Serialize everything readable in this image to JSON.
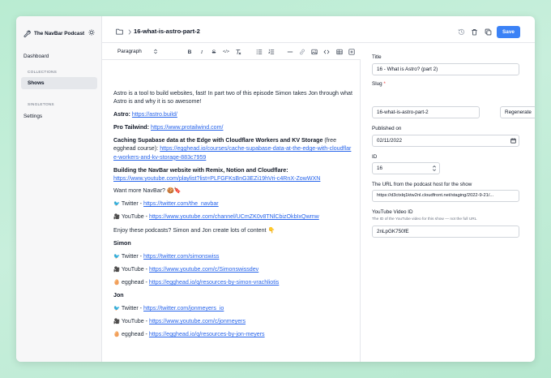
{
  "sidebar": {
    "brand": "The NavBar Podcast",
    "dashboard": "Dashboard",
    "collections_heading": "COLLECTIONS",
    "shows": "Shows",
    "singletons_heading": "SINGLETONS",
    "settings": "Settings"
  },
  "header": {
    "doc_title": "16-what-is-astro-part-2",
    "save_label": "Save"
  },
  "toolbar": {
    "paragraph_label": "Paragraph",
    "bold": "B",
    "italic": "I",
    "strike": "S",
    "code": "</>"
  },
  "content": {
    "intro": "Astro is a tool to build websites, fast! In part two of this episode Simon takes Jon through what Astro is and why it is so awesome!",
    "astro_label": "Astro:",
    "astro_url": "https://astro.build/",
    "tailwind_label": "Pro Tailwind:",
    "tailwind_url": "https://www.protailwind.com/",
    "supabase_label": "Caching Supabase data at the Edge with Cloudflare Workers and KV Storage",
    "supabase_note": " (free egghead course): ",
    "supabase_url": "https://egghead.io/courses/cache-supabase-data-at-the-edge-with-cloudflare-workers-and-kv-storage-883c7959",
    "navbar_build_label": "Building the NavBar website with Remix, Notion and Cloudflare",
    "navbar_build_url": "https://www.youtube.com/playlist?list=PLFGFKsBnG3EZi19hVri-c4RnX-ZowWXN",
    "want_more": "Want more NavBar? 🍪🔖",
    "twitter_prefix": "Twitter - ",
    "navbar_twitter": "https://twitter.com/the_navbar",
    "youtube_prefix": "YouTube - ",
    "navbar_youtube": "https://www.youtube.com/channel/UCmZK0v8TNlCbizOkbIxQwmw",
    "enjoy": "Enjoy these podcasts? Simon and Jon create lots of content 👇",
    "simon": "Simon",
    "simon_twitter": "https://twitter.com/simonswiss",
    "simon_youtube": "https://www.youtube.com/c/Simonswissdev",
    "egghead_prefix": "egghead - ",
    "simon_egghead": "https://egghead.io/q/resources-by-simon-vrachliotis",
    "jon": "Jon",
    "jon_twitter": "https://twitter.com/jonmeyers_io",
    "jon_youtube": "https://www.youtube.com/c/jonmeyers",
    "jon_egghead": "https://egghead.io/q/resources-by-jon-meyers"
  },
  "fields": {
    "title_label": "Title",
    "title_value": "16 - What is Astro? (part 2)",
    "slug_label": "Slug",
    "slug_required": "*",
    "slug_value": "16-what-is-astro-part-2",
    "regenerate_label": "Regenerate",
    "published_label": "Published on",
    "published_value": "02/11/2022",
    "id_label": "ID",
    "id_value": "16",
    "url_label": "The URL from the podcast host for the show",
    "url_value": "https://d3ctxlq1ktw2nl.cloudfront.net/staging/2022-9-21/...",
    "youtube_label": "YouTube Video ID",
    "youtube_hint": "The ID of the YouTube video for this show — not the full URL",
    "youtube_value": "2nLpGK750fE"
  },
  "colors": {
    "accent": "#3b82f6",
    "link": "#2563eb",
    "background": "#bfeed6"
  }
}
